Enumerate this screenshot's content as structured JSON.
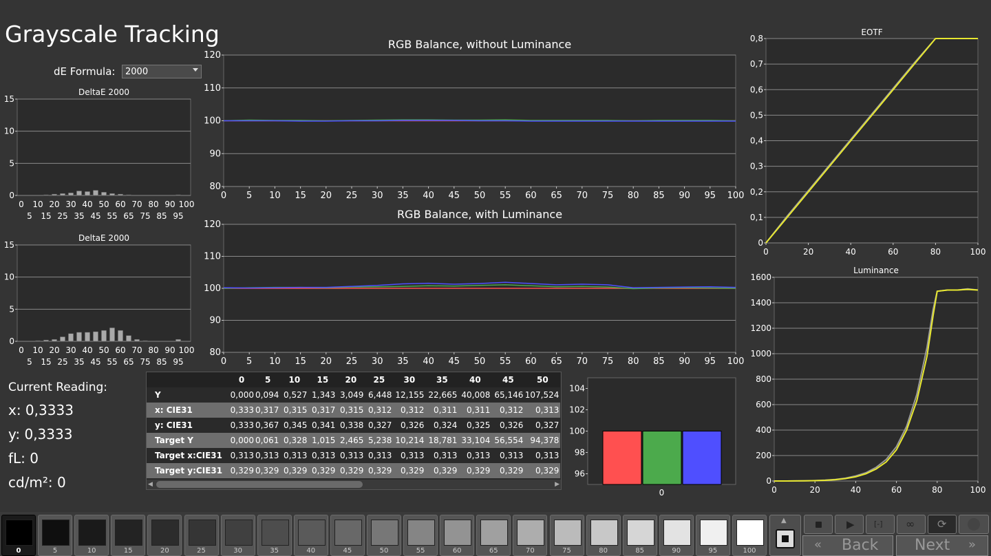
{
  "page": {
    "title": "Grayscale Tracking",
    "de_formula_label": "dE Formula:",
    "de_formula_value": "2000"
  },
  "current_reading": {
    "heading": "Current Reading:",
    "x": "x: 0,3333",
    "y": "y: 0,3333",
    "fl": "fL: 0",
    "cdm2": "cd/m²: 0"
  },
  "table": {
    "headers": [
      "",
      "0",
      "5",
      "10",
      "15",
      "20",
      "25",
      "30",
      "35",
      "40",
      "45",
      "50"
    ],
    "rows": [
      {
        "label": "Y",
        "values": [
          "0,000",
          "0,094",
          "0,527",
          "1,343",
          "3,049",
          "6,448",
          "12,155",
          "22,665",
          "40,008",
          "65,146",
          "107,524"
        ]
      },
      {
        "label": "x: CIE31",
        "values": [
          "0,333",
          "0,317",
          "0,315",
          "0,317",
          "0,315",
          "0,312",
          "0,312",
          "0,311",
          "0,311",
          "0,312",
          "0,313"
        ]
      },
      {
        "label": "y: CIE31",
        "values": [
          "0,333",
          "0,367",
          "0,345",
          "0,341",
          "0,338",
          "0,327",
          "0,326",
          "0,324",
          "0,325",
          "0,326",
          "0,327"
        ]
      },
      {
        "label": "Target Y",
        "values": [
          "0,000",
          "0,061",
          "0,328",
          "1,015",
          "2,465",
          "5,238",
          "10,214",
          "18,781",
          "33,104",
          "56,554",
          "94,378"
        ]
      },
      {
        "label": "Target x:CIE31",
        "values": [
          "0,313",
          "0,313",
          "0,313",
          "0,313",
          "0,313",
          "0,313",
          "0,313",
          "0,313",
          "0,313",
          "0,313",
          "0,313"
        ]
      },
      {
        "label": "Target y:CIE31",
        "values": [
          "0,329",
          "0,329",
          "0,329",
          "0,329",
          "0,329",
          "0,329",
          "0,329",
          "0,329",
          "0,329",
          "0,329",
          "0,329"
        ]
      }
    ]
  },
  "swatches": {
    "labels": [
      "0",
      "5",
      "10",
      "15",
      "20",
      "25",
      "30",
      "35",
      "40",
      "45",
      "50",
      "55",
      "60",
      "65",
      "70",
      "75",
      "80",
      "85",
      "90",
      "95",
      "100"
    ],
    "colors": [
      "#000000",
      "#0f0f0f",
      "#1a1a1a",
      "#232323",
      "#2c2c2c",
      "#353535",
      "#404040",
      "#4d4d4d",
      "#5a5a5a",
      "#686868",
      "#777777",
      "#858585",
      "#939393",
      "#a0a0a0",
      "#adadad",
      "#bbbbbb",
      "#c8c8c8",
      "#d6d6d6",
      "#e3e3e3",
      "#f0f0f0",
      "#ffffff"
    ],
    "selected": "0"
  },
  "nav": {
    "back": "Back",
    "next": "Next"
  },
  "colors": {
    "red": "#ff5050",
    "green": "#4caa4c",
    "blue": "#4f4fff",
    "yellow": "#e8e830",
    "gray_line": "#9a9a9a",
    "plot_bg": "#2b2b2b"
  },
  "chart_data": [
    {
      "type": "bar",
      "title": "DeltaE 2000",
      "categories": [
        "0",
        "5",
        "10",
        "15",
        "20",
        "25",
        "30",
        "35",
        "40",
        "45",
        "50",
        "55",
        "60",
        "65",
        "70",
        "75",
        "80",
        "85",
        "90",
        "95",
        "100"
      ],
      "x_tick_labels_top": [
        "0",
        "10",
        "20",
        "30",
        "40",
        "50",
        "60",
        "70",
        "80",
        "90",
        "100"
      ],
      "x_tick_labels_bottom": [
        "5",
        "15",
        "25",
        "35",
        "45",
        "55",
        "65",
        "75",
        "85",
        "95"
      ],
      "values": [
        0,
        0,
        0,
        0.1,
        0.2,
        0.3,
        0.4,
        0.7,
        0.6,
        0.8,
        0.5,
        0.3,
        0.2,
        0.1,
        0,
        0,
        0,
        0,
        0,
        0.1,
        0
      ],
      "ylim": [
        0,
        15
      ],
      "yticks": [
        0,
        5,
        10,
        15
      ]
    },
    {
      "type": "bar",
      "title": "DeltaE 2000",
      "categories": [
        "0",
        "5",
        "10",
        "15",
        "20",
        "25",
        "30",
        "35",
        "40",
        "45",
        "50",
        "55",
        "60",
        "65",
        "70",
        "75",
        "80",
        "85",
        "90",
        "95",
        "100"
      ],
      "x_tick_labels_top": [
        "0",
        "10",
        "20",
        "30",
        "40",
        "50",
        "60",
        "70",
        "80",
        "90",
        "100"
      ],
      "x_tick_labels_bottom": [
        "5",
        "15",
        "25",
        "35",
        "45",
        "55",
        "65",
        "75",
        "85",
        "95"
      ],
      "values": [
        0,
        0,
        0.1,
        0.2,
        0.3,
        0.7,
        1.2,
        1.4,
        1.4,
        1.5,
        1.7,
        2.1,
        1.7,
        0.9,
        0.3,
        0.1,
        0,
        0,
        0,
        0.3,
        0
      ],
      "ylim": [
        0,
        15
      ],
      "yticks": [
        0,
        5,
        10,
        15
      ]
    },
    {
      "type": "line",
      "title": "RGB Balance, without Luminance",
      "x": [
        0,
        5,
        10,
        15,
        20,
        25,
        30,
        35,
        40,
        45,
        50,
        55,
        60,
        65,
        70,
        75,
        80,
        85,
        90,
        95,
        100
      ],
      "series": [
        {
          "color": "red",
          "values": [
            100,
            100,
            100,
            100,
            100,
            100,
            100,
            100,
            100,
            100,
            100,
            100,
            100,
            100,
            100,
            100,
            100,
            100,
            100,
            100,
            100
          ]
        },
        {
          "color": "green",
          "values": [
            100,
            100.2,
            100.1,
            100.1,
            100,
            100.1,
            100.2,
            100.3,
            100.3,
            100.2,
            100.2,
            100.3,
            100.1,
            100.1,
            100.1,
            100.1,
            100,
            100.1,
            100.1,
            100.1,
            100
          ]
        },
        {
          "color": "blue",
          "values": [
            100,
            100,
            100,
            99.9,
            99.9,
            100,
            100,
            100.1,
            100.1,
            100.1,
            100,
            100,
            99.9,
            99.9,
            99.9,
            99.9,
            99.9,
            99.9,
            99.9,
            99.9,
            99.9
          ]
        }
      ],
      "xlim": [
        0,
        100
      ],
      "ylim": [
        80,
        120
      ],
      "yticks": [
        80,
        90,
        100,
        110,
        120
      ],
      "xticks": [
        0,
        5,
        10,
        15,
        20,
        25,
        30,
        35,
        40,
        45,
        50,
        55,
        60,
        65,
        70,
        75,
        80,
        85,
        90,
        95,
        100
      ]
    },
    {
      "type": "line",
      "title": "RGB Balance, with Luminance",
      "x": [
        0,
        5,
        10,
        15,
        20,
        25,
        30,
        35,
        40,
        45,
        50,
        55,
        60,
        65,
        70,
        75,
        80,
        85,
        90,
        95,
        100
      ],
      "series": [
        {
          "color": "red",
          "values": [
            100,
            100,
            100,
            100,
            100,
            100,
            100,
            100,
            100,
            100,
            100,
            100,
            100,
            100,
            100,
            100,
            100,
            100,
            100,
            100,
            100
          ]
        },
        {
          "color": "green",
          "values": [
            100,
            100.2,
            100.3,
            100.3,
            100.2,
            100.4,
            100.5,
            100.6,
            100.8,
            100.7,
            100.9,
            101.1,
            100.8,
            100.5,
            100.6,
            100.4,
            99.9,
            100.1,
            100.2,
            100.1,
            100
          ]
        },
        {
          "color": "blue",
          "values": [
            100.2,
            100.1,
            100.2,
            100.3,
            100.3,
            100.6,
            100.9,
            101.4,
            101.6,
            101.3,
            101.5,
            101.9,
            101.5,
            101.1,
            101.3,
            101.1,
            100.2,
            100.3,
            100.4,
            100.5,
            100.3
          ]
        }
      ],
      "xlim": [
        0,
        100
      ],
      "ylim": [
        80,
        120
      ],
      "yticks": [
        80,
        90,
        100,
        110,
        120
      ],
      "xticks": [
        0,
        5,
        10,
        15,
        20,
        25,
        30,
        35,
        40,
        45,
        50,
        55,
        60,
        65,
        70,
        75,
        80,
        85,
        90,
        95,
        100
      ]
    },
    {
      "type": "line",
      "title": "EOTF",
      "x": [
        0,
        10,
        20,
        30,
        40,
        50,
        60,
        70,
        80,
        90,
        100
      ],
      "series": [
        {
          "color": "gray",
          "values": [
            0,
            0.105,
            0.205,
            0.305,
            0.405,
            0.505,
            0.605,
            0.705,
            0.8,
            0.8,
            0.8
          ]
        },
        {
          "color": "yellow",
          "values": [
            0,
            0.1,
            0.2,
            0.3,
            0.4,
            0.5,
            0.6,
            0.7,
            0.8,
            0.8,
            0.8
          ]
        }
      ],
      "xlim": [
        0,
        100
      ],
      "ylim": [
        0,
        0.8
      ],
      "yticks": [
        "0",
        "0,1",
        "0,2",
        "0,3",
        "0,4",
        "0,5",
        "0,6",
        "0,7",
        "0,8"
      ],
      "xticks": [
        0,
        20,
        40,
        60,
        80,
        100
      ]
    },
    {
      "type": "line",
      "title": "Luminance",
      "x": [
        0,
        5,
        10,
        15,
        20,
        25,
        30,
        35,
        40,
        45,
        50,
        55,
        60,
        65,
        70,
        75,
        78,
        80,
        85,
        90,
        95,
        100
      ],
      "series": [
        {
          "color": "gray",
          "values": [
            0,
            0.1,
            0.5,
            1.3,
            3,
            6.4,
            12,
            22,
            40,
            65,
            107,
            170,
            270,
            430,
            680,
            1050,
            1350,
            1490,
            1500,
            1500,
            1510,
            1500
          ]
        },
        {
          "color": "yellow",
          "values": [
            0,
            0.1,
            0.3,
            1,
            2.5,
            5.2,
            10,
            19,
            33,
            57,
            94,
            150,
            245,
            400,
            630,
            980,
            1300,
            1490,
            1500,
            1500,
            1505,
            1500
          ]
        }
      ],
      "xlim": [
        0,
        100
      ],
      "ylim": [
        0,
        1600
      ],
      "yticks": [
        0,
        200,
        400,
        600,
        800,
        1000,
        1200,
        1400,
        1600
      ],
      "xticks": [
        0,
        20,
        40,
        60,
        80,
        100
      ]
    },
    {
      "type": "bar",
      "title": "",
      "categories": [
        "0"
      ],
      "series": [
        {
          "color": "red",
          "values": [
            100
          ]
        },
        {
          "color": "green",
          "values": [
            100
          ]
        },
        {
          "color": "blue",
          "values": [
            100
          ]
        }
      ],
      "ylim": [
        95,
        105
      ],
      "yticks": [
        96,
        98,
        100,
        102,
        104
      ]
    }
  ]
}
